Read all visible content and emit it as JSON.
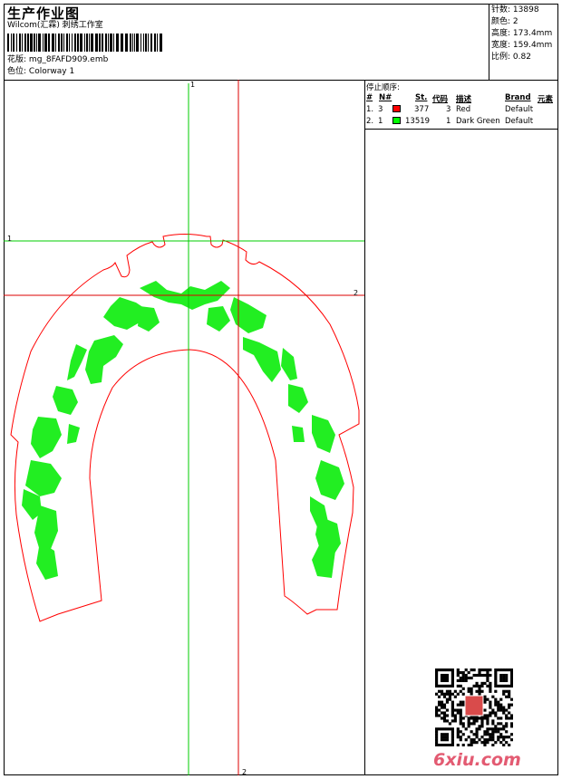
{
  "header": {
    "title": "生产作业图",
    "company": "Wilcom(汇霖) 刺绣工作室",
    "design_label": "花版:",
    "design_file": "mg_8FAFD909.emb",
    "colorway_label": "色位:",
    "colorway": "Colorway 1"
  },
  "stats": [
    {
      "label": "针数:",
      "value": "13898"
    },
    {
      "label": "颜色:",
      "value": "2"
    },
    {
      "label": "高度:",
      "value": "173.4mm"
    },
    {
      "label": "宽度:",
      "value": "159.4mm"
    },
    {
      "label": "比例:",
      "value": "0.82"
    }
  ],
  "stop_sequence": {
    "title": "停止顺序:",
    "headers": {
      "num": "#",
      "n": "N#",
      "st": "St.",
      "code": "代码",
      "desc": "描述",
      "brand": "Brand",
      "elements": "元素"
    },
    "rows": [
      {
        "num": "1.",
        "n": "3",
        "color": "#ff0000",
        "st": "377",
        "code": "3",
        "desc": "Red",
        "brand": "Default"
      },
      {
        "num": "2.",
        "n": "1",
        "color": "#00ff00",
        "st": "13519",
        "code": "1",
        "desc": "Dark Green",
        "brand": "Default"
      }
    ]
  },
  "guides": {
    "v1": "1",
    "v2": "2",
    "h1": "1",
    "h2": "2"
  },
  "colors": {
    "outline": "#ff0000",
    "fill": "#22ee22",
    "guide_green": "#00cc00",
    "guide_red": "#dd0000"
  },
  "watermark": "6xiu.com"
}
